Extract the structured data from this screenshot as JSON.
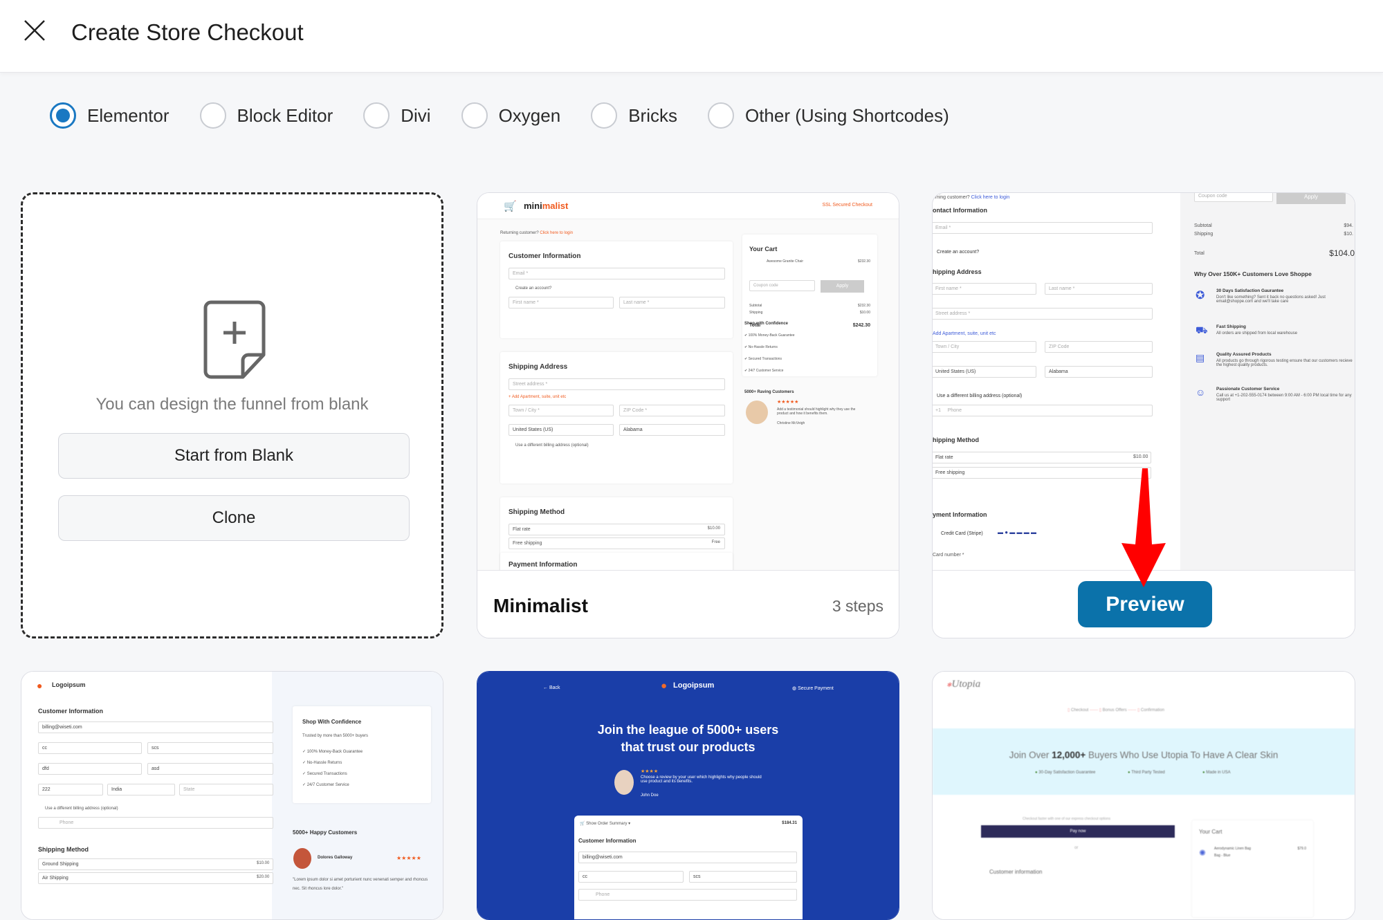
{
  "header": {
    "title": "Create Store Checkout",
    "close_icon": "close-icon"
  },
  "builders": {
    "selected": "Elementor",
    "options": [
      "Elementor",
      "Block Editor",
      "Divi",
      "Oxygen",
      "Bricks",
      "Other (Using Shortcodes)"
    ]
  },
  "accent": "#1a78c2",
  "blank_card": {
    "icon": "file-plus-icon",
    "text": "You can design the funnel from blank",
    "start_label": "Start from Blank",
    "clone_label": "Clone"
  },
  "templates": [
    {
      "name": "Minimalist",
      "steps": "3 steps",
      "thumb": {
        "logo_a": "mini",
        "logo_b": "malist",
        "ssl": "SSL Secured Checkout",
        "returning": "Returning customer?",
        "login": "Click here to login",
        "customer_info": "Customer Information",
        "email": "Email *",
        "create_account": "Create an account?",
        "first": "First name *",
        "last": "Last name *",
        "shipping_address": "Shipping Address",
        "street": "Street address *",
        "add_apartment": "+ Add Apartment, suite, unit etc",
        "town": "Town / City *",
        "zip": "ZIP Code *",
        "country": "United States (US)",
        "state": "Alabama",
        "different_billing": "Use a different billing address (optional)",
        "shipping_method": "Shipping Method",
        "flat_rate": "Flat rate",
        "flat_price": "$10.00",
        "free_shipping": "Free shipping",
        "free": "Free",
        "payment": "Payment Information",
        "your_cart": "Your Cart",
        "product": "Awesome Granite Chair",
        "product_price": "$232.30",
        "coupon": "Coupon code",
        "apply": "Apply",
        "subtotal": "Subtotal",
        "subtotal_val": "$232.30",
        "shipping": "Shipping",
        "shipping_val": "$10.00",
        "total": "Total",
        "total_val": "$242.30",
        "confidence": "Shop with Confidence",
        "perks": [
          "100% Money-Back Guarantee",
          "No-Hassle Returns",
          "Secured Transactions",
          "24/7 Customer Service"
        ],
        "raving": "5000+ Raving Customers",
        "testimonial": "Add a testimonial should highlight why they use the product and how it benefits them.",
        "author": "Christine McVeigh"
      }
    },
    {
      "preview_label": "Preview",
      "thumb": {
        "returning": "oming customer?",
        "login": "Click here to login",
        "contact": "ontact Information",
        "email": "Email *",
        "create_account": "Create an account?",
        "shipping_address": "hipping Address",
        "first": "First name *",
        "last": "Last name *",
        "street": "Street address *",
        "add_apartment": "Add Apartment, suite, unit etc",
        "town": "Town / City",
        "zip": "ZIP Code",
        "country": "United States (US)",
        "state": "Alabama",
        "different_billing": "Use a different billing address (optional)",
        "phone_code": "+1",
        "phone": "Phone",
        "shipping_method": "hipping Method",
        "flat_rate": "Flat rate",
        "flat_price": "$10.00",
        "free_shipping": "Free shipping",
        "payment": "yment Information",
        "credit_card": "Credit Card (Stripe)",
        "card_number": "Card number *",
        "coupon": "Coupon code",
        "apply": "Apply",
        "subtotal": "Subtotal",
        "subtotal_val": "$94.",
        "shipping": "Shipping",
        "shipping_val": "$10.",
        "total": "Total",
        "total_val": "$104.0",
        "why": "Why Over 150K+ Customers Love Shoppe",
        "features": [
          {
            "title": "30 Days Satisfaction Gaurantee",
            "desc": "Don't like something? Sent it back no questions asked! Just email@shoppe.com and we'll take care"
          },
          {
            "title": "Fast Shipping",
            "desc": "All orders are shipped from local warehouse"
          },
          {
            "title": "Quality Assured Products",
            "desc": "All products go through rigorous testing ensure that our customers recieve the highest quality products."
          },
          {
            "title": "Passionate Customer Service",
            "desc": "Call us at +1-202-555-0174 between 9:00 AM - 6:00 PM local time for any support"
          }
        ]
      }
    },
    {
      "thumb": {
        "logo": "Logoipsum",
        "customer_info": "Customer Information",
        "email_val": "billing@wiseti.com",
        "first_val": "cc",
        "last_val": "scs",
        "street_val": "dfd",
        "town_val": "asd",
        "pin_val": "222",
        "country_val": "India",
        "state": "State",
        "different_billing": "Use a different billing address (optional)",
        "phone": "Phone",
        "shipping_method": "Shipping Method",
        "ground": "Ground Shipping",
        "ground_price": "$10.00",
        "air": "Air Shipping",
        "air_price": "$20.00",
        "confidence": "Shop With Confidence",
        "trusted": "Trusted by more than 5000+ buyers",
        "perks": [
          "100% Money-Back Guarantee",
          "No-Hassle Returns",
          "Secured Transactions",
          "24/7 Customer Service"
        ],
        "happy": "5000+ Happy Customers",
        "reviewer": "Dolores Galloway",
        "quote": "\"Lorem ipsum dolor si amet porturient nunc venenati semper and rhoncus nec. Sit rhoncus lore dolor.\""
      }
    },
    {
      "thumb": {
        "back": "← Back",
        "logo": "Logoipsum",
        "secure": "Secure Payment",
        "headline1": "Join the league of 5000+ users",
        "headline2": "that trust our products",
        "review": "Choose a review by your user which highlights why people should use product and its benefits.",
        "author": "John Doe",
        "order_summary": "Show Order Summary",
        "order_total": "$184.31",
        "customer_info": "Customer Information",
        "email_val": "billing@wiseti.com",
        "first_val": "cc",
        "last_val": "scs",
        "phone": "Phone",
        "bg": "#1a3ea8"
      }
    },
    {
      "thumb": {
        "logo": "Utopia",
        "steps": [
          "Checkout",
          "Bonus Offers",
          "Confirmation"
        ],
        "headline_a": "Join Over ",
        "headline_b": "12,000+",
        "headline_c": " Buyers Who Use Utopia To Have A Clear Skin",
        "badges": [
          "30-Day Satisfaction Guarantee",
          "Third Party Tested",
          "Made in USA"
        ],
        "express": "Checkout faster with one of our express checkout options",
        "pay_now": "Pay now",
        "or": "or",
        "customer_info": "Customer information",
        "your_cart": "Your Cart",
        "product": "Aerodynamic Linen Bag",
        "variant": "Bag - Blue",
        "price": "$79.0",
        "banner_bg": "#dff6fd"
      }
    }
  ]
}
